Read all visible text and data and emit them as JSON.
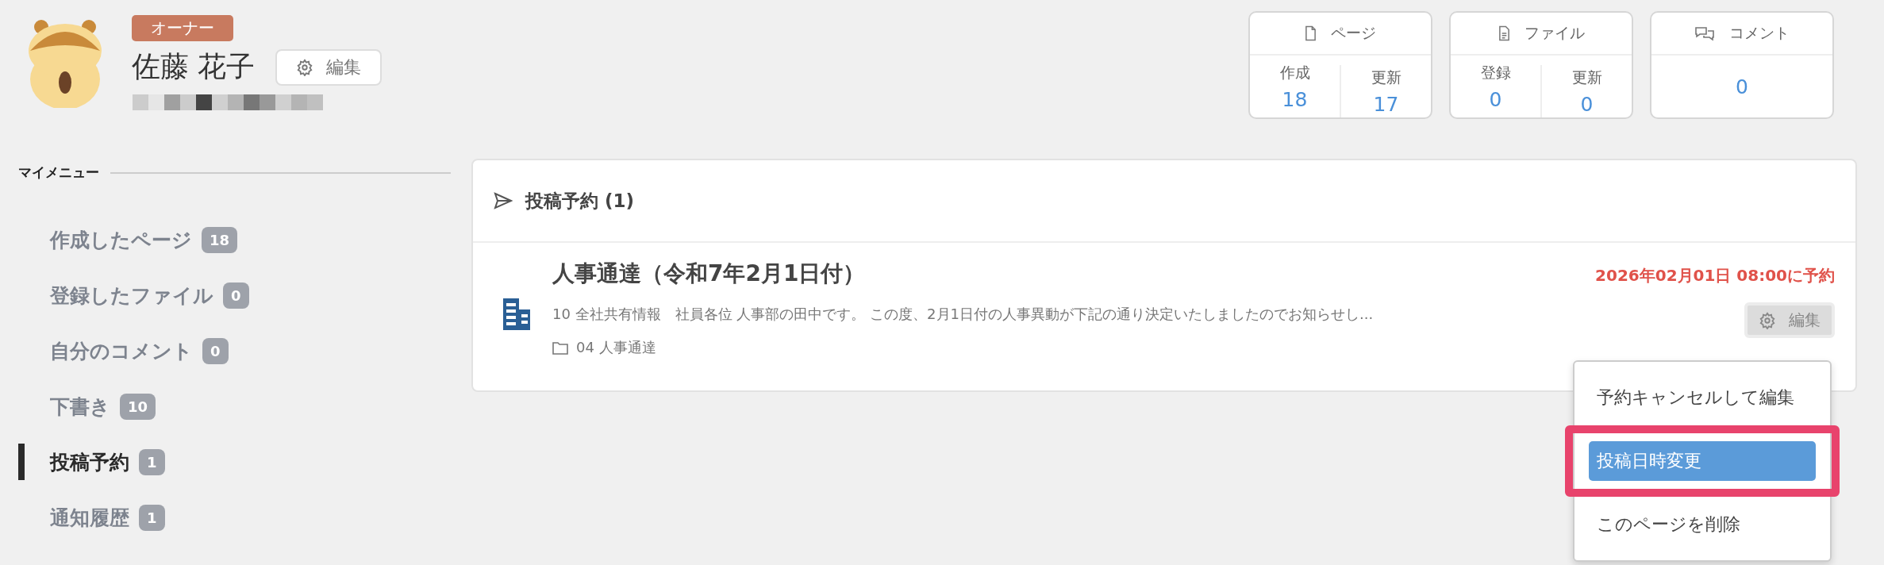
{
  "profile": {
    "role_badge": "オーナー",
    "name": "佐藤 花子",
    "edit_button": "編集"
  },
  "stats": [
    {
      "title": "ページ",
      "cells": [
        {
          "label": "作成",
          "value": "18"
        },
        {
          "label": "更新",
          "value": "17"
        }
      ]
    },
    {
      "title": "ファイル",
      "cells": [
        {
          "label": "登録",
          "value": "0"
        },
        {
          "label": "更新",
          "value": "0"
        }
      ]
    },
    {
      "title": "コメント",
      "cells": [
        {
          "value": "0"
        }
      ]
    }
  ],
  "sidebar": {
    "heading": "マイメニュー",
    "items": [
      {
        "label": "作成したページ",
        "count": "18",
        "selected": false
      },
      {
        "label": "登録したファイル",
        "count": "0",
        "selected": false
      },
      {
        "label": "自分のコメント",
        "count": "0",
        "selected": false
      },
      {
        "label": "下書き",
        "count": "10",
        "selected": false
      },
      {
        "label": "投稿予約",
        "count": "1",
        "selected": true
      },
      {
        "label": "通知履歴",
        "count": "1",
        "selected": false
      }
    ]
  },
  "panel": {
    "title": "投稿予約 (1)",
    "posts": [
      {
        "title": "人事通達（令和7年2月1日付）",
        "scheduled": "2026年02月01日 08:00に予約",
        "snippet": "10 全社共有情報　社員各位 人事部の田中です。 この度、2月1日付の人事異動が下記の通り決定いたしましたのでお知らせし...",
        "folder": "04 人事通達",
        "edit_button": "編集"
      }
    ]
  },
  "dropdown": {
    "items": [
      {
        "label": "予約キャンセルして編集",
        "selected": false,
        "highlighted": false
      },
      {
        "label": "投稿日時変更",
        "selected": true,
        "highlighted": true
      },
      {
        "label": "このページを削除",
        "selected": false,
        "highlighted": false
      }
    ]
  }
}
